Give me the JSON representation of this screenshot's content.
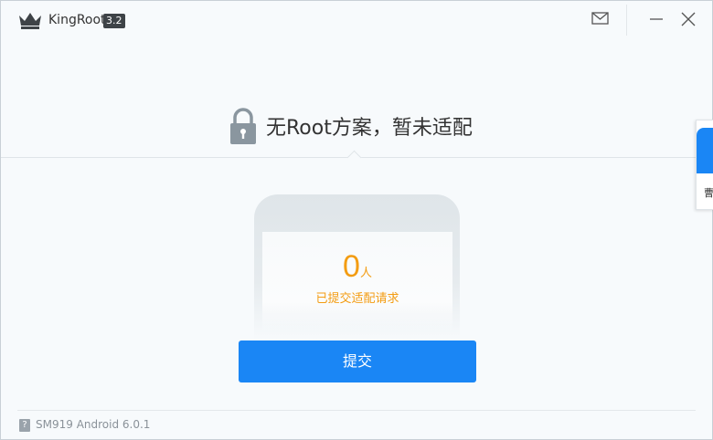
{
  "window": {
    "app_name": "KingRoot",
    "version": "3.2"
  },
  "main": {
    "headline": "无Root方案，暂未适配",
    "request_count": "0",
    "count_unit": "人",
    "count_label": "已提交适配请求",
    "submit_label": "提交"
  },
  "footer": {
    "help_glyph": "?",
    "device_info": "SM919 Android 6.0.1"
  },
  "side_widget": {
    "text": "曹"
  },
  "colors": {
    "accent_blue": "#1a86f5",
    "count_orange": "#f39c12",
    "lock_gray": "#8a969f"
  }
}
